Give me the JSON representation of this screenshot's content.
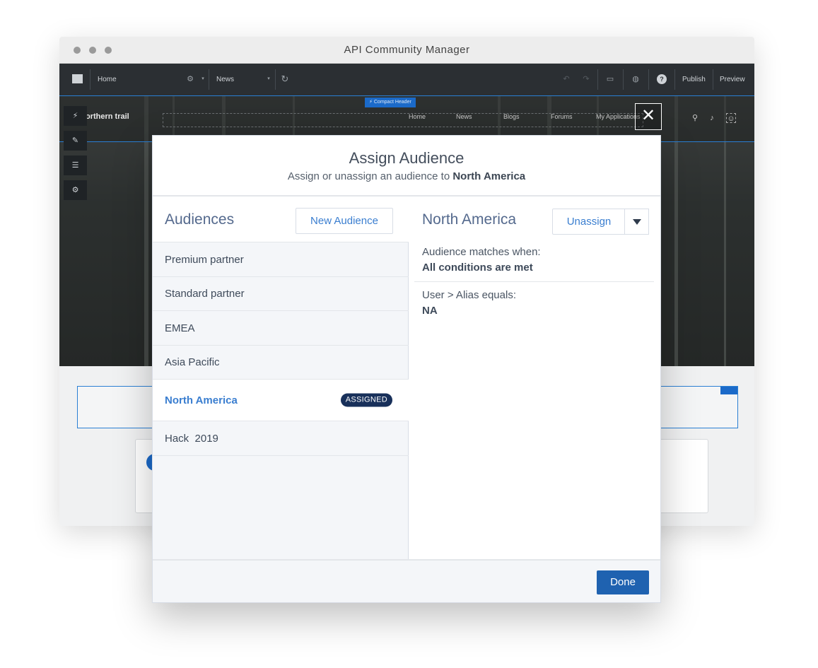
{
  "window": {
    "title": "API Community Manager"
  },
  "toolbar": {
    "page_select": "Home",
    "second_select": "News",
    "publish_label": "Publish",
    "preview_label": "Preview"
  },
  "site": {
    "logo_text": "orthern trail",
    "compact_header_label": "Compact Header",
    "nav_links": [
      "Home",
      "News",
      "Blogs",
      "Forums",
      "My Applications"
    ]
  },
  "modal": {
    "title": "Assign Audience",
    "subtitle_prefix": "Assign or unassign an audience to ",
    "subtitle_target": "North America",
    "left": {
      "title": "Audiences",
      "new_button": "New Audience",
      "items": [
        {
          "label": "Premium partner"
        },
        {
          "label": "Standard partner"
        },
        {
          "label": "EMEA"
        },
        {
          "label": "Asia Pacific"
        },
        {
          "label": "North America",
          "badge": "ASSIGNED"
        },
        {
          "label": "Hack  2019"
        }
      ]
    },
    "right": {
      "title": "North America",
      "unassign_button": "Unassign",
      "match_label": "Audience matches when:",
      "match_value": "All conditions are met",
      "criteria_label": "User > Alias equals:",
      "criteria_value": "NA"
    },
    "footer": {
      "done_button": "Done"
    }
  },
  "colors": {
    "accent_blue": "#1f62b0",
    "link_blue": "#3a7ed0",
    "badge_navy": "#18305a"
  }
}
